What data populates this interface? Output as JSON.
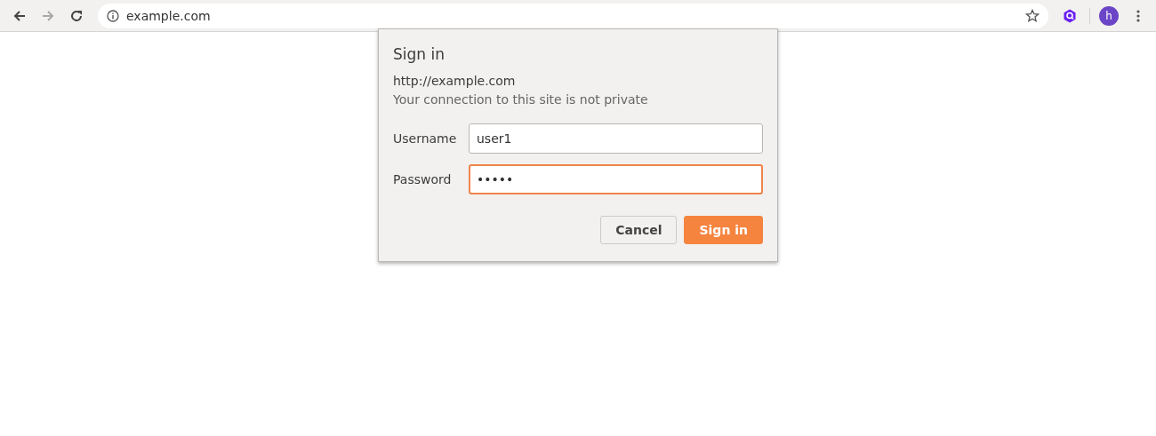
{
  "toolbar": {
    "nav_buttons": [
      {
        "kind": "back",
        "disabled": false
      },
      {
        "kind": "forward",
        "disabled": true
      },
      {
        "kind": "reload",
        "disabled": false
      }
    ],
    "address": "example.com",
    "avatar": "h"
  },
  "dialog": {
    "title": "Sign in",
    "origin": "http://example.com",
    "warning": "Your connection to this site is not private",
    "fields": [
      {
        "label": "Username",
        "value": "user1",
        "focused": false
      },
      {
        "label": "Password",
        "value": "•••••",
        "focused": true
      }
    ],
    "buttons": [
      {
        "label": "Cancel",
        "kind": "secondary"
      },
      {
        "label": "Sign in",
        "kind": "primary"
      }
    ]
  }
}
